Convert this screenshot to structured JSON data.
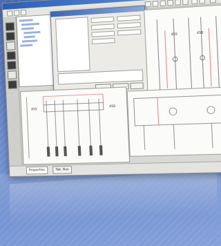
{
  "tabs": [
    {
      "label": "Properties"
    },
    {
      "label": "Tab. Bus"
    }
  ],
  "schematic": {
    "upper_labels": [
      "4S5",
      "4S8"
    ],
    "lower_labels": [
      "4S5",
      "4S6"
    ]
  },
  "colors": {
    "desktop": "#6f8fd0",
    "titlebar": "#2c5fb4",
    "wire_red": "#d43a3a"
  }
}
